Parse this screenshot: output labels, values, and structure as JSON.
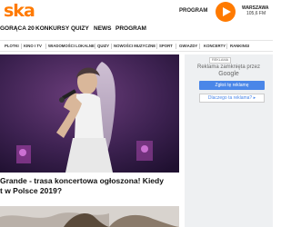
{
  "header": {
    "logo": "ska",
    "program_label": "PROGRAM",
    "station_name": "WARSZAWA",
    "station_freq": "105,6 FM",
    "colors": {
      "brand": "#ff7a00"
    }
  },
  "main_nav": {
    "items": [
      "GORĄCA 20",
      "KONKURSY",
      "QUIZY",
      "NEWS",
      "PROGRAM"
    ]
  },
  "sub_nav": {
    "items": [
      "PLOTKI",
      "KINO I TV",
      "WIADOMOŚCI LOKALNE",
      "QUIZY",
      "NOWOŚCI MUZYCZNE",
      "SPORT",
      "GWIAZDY",
      "KONCERTY",
      "RANKINGI"
    ]
  },
  "article": {
    "title_line1": "Grande - trasa koncertowa ogłoszona! Kiedy",
    "title_line2": "t w Polsce 2019?"
  },
  "ad": {
    "badge": "REKLAMA",
    "closed_text": "Reklama zamknięta przez",
    "provider": "Google",
    "report_button": "Zgłoś tę reklamę",
    "why_button": "Dlaczego ta reklama?",
    "why_icon": "arrow-right-icon",
    "colors": {
      "button": "#4a86e8"
    }
  },
  "hero": {
    "icon": "concert-photo"
  }
}
